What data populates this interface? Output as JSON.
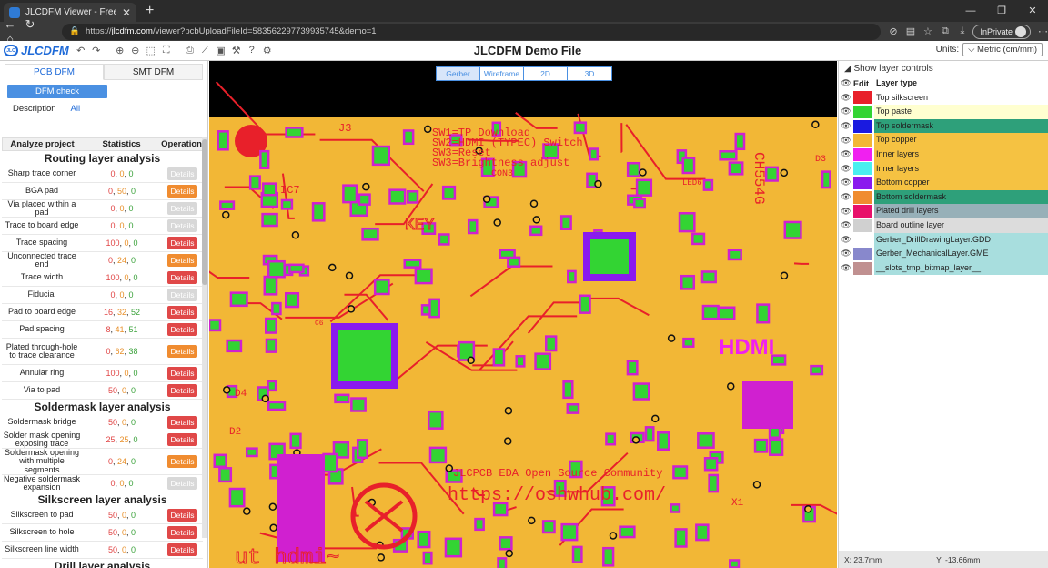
{
  "browser": {
    "tab_title": "JLCDFM Viewer - Free Online PCB",
    "url_prefix": "https://",
    "url_host": "jlcdfm.com",
    "url_rest": "/viewer?pcbUploadFileId=583562297739935745&demo=1",
    "inprivate": "InPrivate"
  },
  "app": {
    "logo": "JLCDFM",
    "logo_badge": "JLC",
    "page_title": "JLCDFM Demo File",
    "units_label": "Units:",
    "units_value": "Metric (cm/mm)"
  },
  "left": {
    "tabs": [
      "PCB DFM",
      "SMT DFM"
    ],
    "dfm_check": "DFM check",
    "description": "Description",
    "all": "All",
    "headers": [
      "Analyze project",
      "Statistics",
      "Operation"
    ],
    "sections": [
      {
        "title": "Routing layer analysis",
        "rows": [
          {
            "name": "Sharp trace corner",
            "s": [
              "0",
              "0",
              "0"
            ],
            "btn": "Details",
            "style": "gry"
          },
          {
            "name": "BGA pad",
            "s": [
              "0",
              "50",
              "0"
            ],
            "btn": "Details",
            "style": "org"
          },
          {
            "name": "Via placed within a pad",
            "s": [
              "0",
              "0",
              "0"
            ],
            "btn": "Details",
            "style": "gry"
          },
          {
            "name": "Trace to board edge",
            "s": [
              "0",
              "0",
              "0"
            ],
            "btn": "Details",
            "style": "gry"
          },
          {
            "name": "Trace spacing",
            "s": [
              "100",
              "0",
              "0"
            ],
            "btn": "Details",
            "style": "red"
          },
          {
            "name": "Unconnected trace end",
            "s": [
              "0",
              "24",
              "0"
            ],
            "btn": "Details",
            "style": "org"
          },
          {
            "name": "Trace width",
            "s": [
              "100",
              "0",
              "0"
            ],
            "btn": "Details",
            "style": "red"
          },
          {
            "name": "Fiducial",
            "s": [
              "0",
              "0",
              "0"
            ],
            "btn": "Details",
            "style": "gry"
          },
          {
            "name": "Pad to board edge",
            "s": [
              "16",
              "32",
              "52"
            ],
            "btn": "Details",
            "style": "red"
          },
          {
            "name": "Pad spacing",
            "s": [
              "8",
              "41",
              "51"
            ],
            "btn": "Details",
            "style": "red"
          },
          {
            "name": "Plated through-hole to trace clearance",
            "s": [
              "0",
              "62",
              "38"
            ],
            "btn": "Details",
            "style": "org",
            "tall": true
          },
          {
            "name": "Annular ring",
            "s": [
              "100",
              "0",
              "0"
            ],
            "btn": "Details",
            "style": "red"
          },
          {
            "name": "Via to pad",
            "s": [
              "50",
              "0",
              "0"
            ],
            "btn": "Details",
            "style": "red"
          }
        ]
      },
      {
        "title": "Soldermask layer analysis",
        "rows": [
          {
            "name": "Soldermask bridge",
            "s": [
              "50",
              "0",
              "0"
            ],
            "btn": "Details",
            "style": "red"
          },
          {
            "name": "Solder mask opening exposing trace",
            "s": [
              "25",
              "25",
              "0"
            ],
            "btn": "Details",
            "style": "red"
          },
          {
            "name": "Soldermask opening with multiple segments",
            "s": [
              "0",
              "24",
              "0"
            ],
            "btn": "Details",
            "style": "org",
            "tall": true
          },
          {
            "name": "Negative soldermask expansion",
            "s": [
              "0",
              "0",
              "0"
            ],
            "btn": "Details",
            "style": "gry"
          }
        ]
      },
      {
        "title": "Silkscreen layer analysis",
        "rows": [
          {
            "name": "Silkscreen to pad",
            "s": [
              "50",
              "0",
              "0"
            ],
            "btn": "Details",
            "style": "red"
          },
          {
            "name": "Silkscreen to hole",
            "s": [
              "50",
              "0",
              "0"
            ],
            "btn": "Details",
            "style": "red"
          },
          {
            "name": "Silkscreen line width",
            "s": [
              "50",
              "0",
              "0"
            ],
            "btn": "Details",
            "style": "red"
          }
        ]
      },
      {
        "title": "Drill layer analysis",
        "rows": []
      }
    ]
  },
  "viewer": {
    "modes": [
      "Gerber",
      "Wireframe",
      "2D",
      "3D"
    ],
    "pcb_text": [
      "SW1=TP Download",
      "SW2=HDMI (TYPEC) Switch",
      "SW3=Reset",
      "SW3=Brightness adjust",
      "CON3",
      "J3",
      "IC7",
      "LED6",
      "D3",
      "CH554G",
      "KEY",
      "HDMI",
      "X1",
      "D2",
      "D4",
      "C6",
      "https://oshwhub.com/",
      "JLCPCB EDA Open Source Community",
      "ut hdmi~"
    ]
  },
  "layers": {
    "toggle": "Show layer controls",
    "col_edit": "Edit",
    "col_type": "Layer type",
    "items": [
      {
        "name": "Top silkscreen",
        "color": "#e8202a",
        "bg": "#ffffff"
      },
      {
        "name": "Top paste",
        "color": "#33d433",
        "bg": "#ffffd0"
      },
      {
        "name": "Top soldermask",
        "color": "#1a1ae0",
        "bg": "#2ea07a"
      },
      {
        "name": "Top copper",
        "color": "#f2b736",
        "bg": "#f5c242"
      },
      {
        "name": "Inner layers",
        "color": "#f020f0",
        "bg": "#f5c242"
      },
      {
        "name": "Inner layers",
        "color": "#4af0f0",
        "bg": "#f5c242"
      },
      {
        "name": "Bottom copper",
        "color": "#8a1aee",
        "bg": "#f5c242"
      },
      {
        "name": "Bottom soldermask",
        "color": "#f08c30",
        "bg": "#2ea07a"
      },
      {
        "name": "Plated drill layers",
        "color": "#e8106a",
        "bg": "#97b0b8"
      },
      {
        "name": "Board outline layer",
        "color": "#d0d0d0",
        "bg": "#dcdcdc"
      },
      {
        "name": "Gerber_DrillDrawingLayer.GDD",
        "color": "#ffffff",
        "bg": "#a8dede"
      },
      {
        "name": "Gerber_MechanicalLayer.GME",
        "color": "#8888cc",
        "bg": "#a8dede"
      },
      {
        "name": "__slots_tmp_bitmap_layer__",
        "color": "#c09090",
        "bg": "#a8dede"
      }
    ]
  },
  "status": {
    "x": "X: 23.7mm",
    "y": "Y: -13.66mm"
  }
}
